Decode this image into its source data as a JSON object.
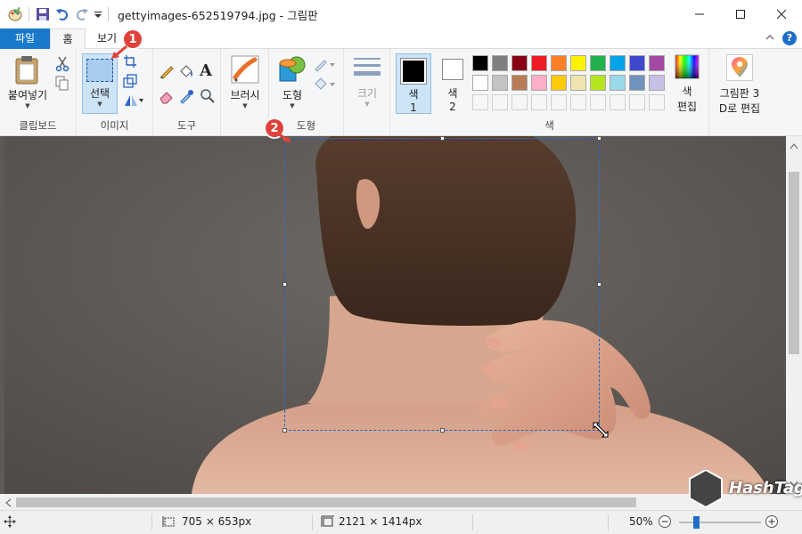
{
  "window": {
    "title": "gettyimages-652519794.jpg - 그림판",
    "icons": [
      "paint-icon",
      "save-icon",
      "undo-icon",
      "redo-icon",
      "customize-icon"
    ]
  },
  "tabs": [
    {
      "label": "파일"
    },
    {
      "label": "홈"
    },
    {
      "label": "보기"
    }
  ],
  "ribbon": {
    "clipboard": {
      "paste_label": "붙여넣기",
      "group_label": "클립보드"
    },
    "image": {
      "select_label": "선택",
      "group_label": "이미지"
    },
    "tools": {
      "group_label": "도구"
    },
    "brushes": {
      "label": "브러시"
    },
    "shapes": {
      "label": "도형",
      "group_label": "도형"
    },
    "size": {
      "label": "크기"
    },
    "colors": {
      "color1_label": "색\n1",
      "color1_line1": "색",
      "color1_line2": "1",
      "color2_line1": "색",
      "color2_line2": "2",
      "edit_line1": "색",
      "edit_line2": "편집",
      "group_label": "색",
      "color1": "#000000",
      "color2": "#ffffff",
      "palette_row1": [
        "#000000",
        "#7f7f7f",
        "#880015",
        "#ed1c24",
        "#ff7f27",
        "#fff200",
        "#22b14c",
        "#00a2e8",
        "#3f48cc",
        "#a349a4"
      ],
      "palette_row2": [
        "#ffffff",
        "#c3c3c3",
        "#b97a57",
        "#ffaec9",
        "#ffc90e",
        "#efe4b0",
        "#b5e61d",
        "#99d9ea",
        "#7092be",
        "#c8bfe7"
      ],
      "palette_row3": [
        "#f5f6f7",
        "#f5f6f7",
        "#f5f6f7",
        "#f5f6f7",
        "#f5f6f7",
        "#f5f6f7",
        "#f5f6f7",
        "#f5f6f7",
        "#f5f6f7",
        "#f5f6f7"
      ]
    },
    "paint3d": {
      "line1": "그림판 3",
      "line2": "D로 편집"
    }
  },
  "annotations": {
    "badge1": "1",
    "badge2": "2"
  },
  "status": {
    "selection_size": "705 × 653px",
    "image_size": "2121 × 1414px",
    "zoom": "50%"
  },
  "watermark": {
    "text": "HashTag"
  }
}
